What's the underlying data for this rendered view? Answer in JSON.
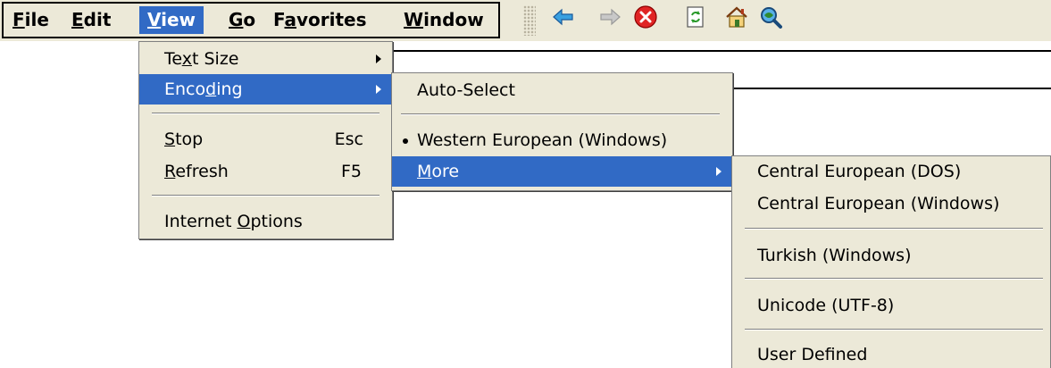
{
  "menubar": {
    "items": [
      {
        "label_pre": "",
        "label_u": "F",
        "label_post": "ile"
      },
      {
        "label_pre": "",
        "label_u": "E",
        "label_post": "dit"
      },
      {
        "label_pre": "",
        "label_u": "V",
        "label_post": "iew"
      },
      {
        "label_pre": "",
        "label_u": "G",
        "label_post": "o"
      },
      {
        "label_pre": "F",
        "label_u": "a",
        "label_post": "vorites"
      },
      {
        "label_pre": "",
        "label_u": "W",
        "label_post": "indow"
      }
    ],
    "active_index": 2
  },
  "toolbar": {
    "buttons": [
      "back-icon",
      "forward-icon",
      "stop-icon",
      "refresh-icon",
      "home-icon",
      "search-icon"
    ]
  },
  "view_menu": {
    "items": [
      {
        "pre": "Te",
        "u": "x",
        "post": "t Size",
        "accel": "",
        "submenu": true
      },
      {
        "pre": "Enco",
        "u": "d",
        "post": "ing",
        "accel": "",
        "submenu": true
      },
      {
        "pre": "",
        "u": "S",
        "post": "top",
        "accel": "Esc",
        "submenu": false
      },
      {
        "pre": "",
        "u": "R",
        "post": "efresh",
        "accel": "F5",
        "submenu": false
      },
      {
        "pre": "Internet ",
        "u": "O",
        "post": "ptions",
        "accel": "",
        "submenu": false
      }
    ]
  },
  "encoding_menu": {
    "items": [
      {
        "label": "Auto-Select"
      },
      {
        "label": "Western European (Windows)",
        "checked": true
      },
      {
        "pre": "",
        "u": "M",
        "post": "ore",
        "submenu": true
      }
    ]
  },
  "more_menu": {
    "items": [
      {
        "label": "Central European (DOS)"
      },
      {
        "label": "Central European (Windows)"
      },
      {
        "label": "Turkish (Windows)"
      },
      {
        "label": "Unicode (UTF-8)"
      },
      {
        "label": "User Defined"
      }
    ]
  },
  "colors": {
    "highlight": "#316ac5",
    "menu_bg": "#ece9d8"
  }
}
